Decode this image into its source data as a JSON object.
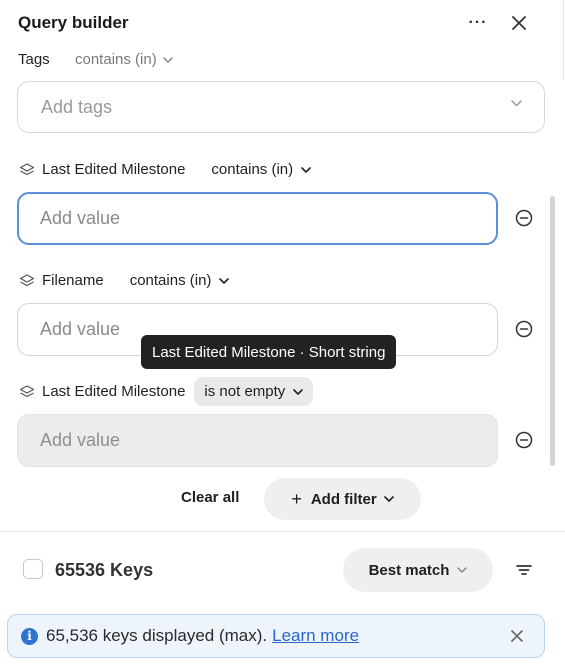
{
  "header": {
    "title": "Query builder",
    "more_icon": "more-horizontal-icon",
    "close_icon": "close-icon"
  },
  "tags_filter": {
    "label": "Tags",
    "operator": "contains (in)",
    "placeholder": "Add tags"
  },
  "filters": [
    {
      "field": "Last Edited Milestone",
      "operator": "contains (in)",
      "placeholder": "Add value",
      "state": "focused"
    },
    {
      "field": "Filename",
      "operator": "contains (in)",
      "placeholder": "Add value",
      "state": "normal"
    },
    {
      "field": "Last Edited Milestone",
      "operator": "is not empty",
      "placeholder": "Add value",
      "state": "disabled"
    }
  ],
  "tooltip": {
    "text": "Last Edited Milestone · Short string"
  },
  "actions": {
    "clear_all": "Clear all",
    "add_filter": "Add filter",
    "add_filter_icon": "+"
  },
  "results": {
    "count_label": "65536 Keys",
    "sort_label": "Best match",
    "filter_icon": "filter-lines-icon"
  },
  "banner": {
    "message": "65,536 keys displayed (max).",
    "link": "Learn more",
    "info_icon": "i"
  },
  "colors": {
    "focus_border": "#5b8fd6",
    "banner_bg": "#eef4fc",
    "banner_border": "#bcd3f1",
    "info_blue": "#2f74d0",
    "link_blue": "#2a66c8",
    "tooltip_bg": "#222222"
  }
}
